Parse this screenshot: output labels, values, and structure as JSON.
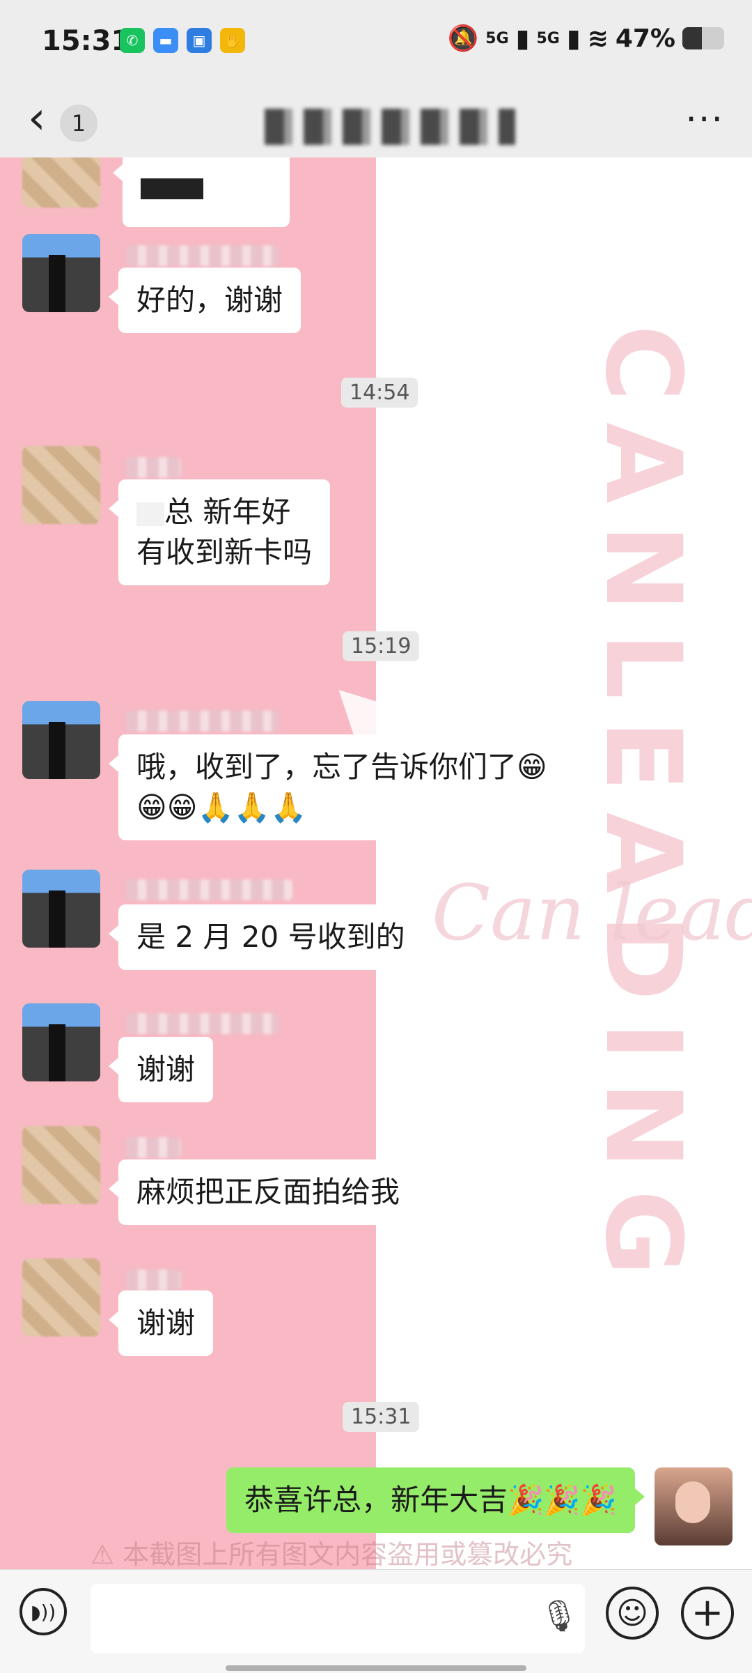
{
  "status_bar": {
    "time": "15:31",
    "network_1": "5G",
    "network_2": "5G",
    "battery_text": "47%",
    "battery_level": 0.47
  },
  "nav": {
    "unread_count": "1"
  },
  "watermarks": {
    "vertical_text": "CANLEADING",
    "brand_text": "Can leading",
    "bottom_caption": "⚠ 本截图上所有图文内容盗用或篡改必究"
  },
  "messages": [
    {
      "type": "text",
      "side": "left",
      "text": "好的，谢谢"
    },
    {
      "type": "time",
      "text": "14:54"
    },
    {
      "type": "text",
      "side": "left",
      "line1": "总 新年好",
      "line2": "有收到新卡吗"
    },
    {
      "type": "time",
      "text": "15:19"
    },
    {
      "type": "text",
      "side": "left",
      "line1": "哦，收到了，忘了告诉你们了😁",
      "line2": "😁😁🙏🙏🙏"
    },
    {
      "type": "text",
      "side": "left",
      "text": "是 2 月 20 号收到的"
    },
    {
      "type": "text",
      "side": "left",
      "text": "谢谢"
    },
    {
      "type": "text",
      "side": "left",
      "text": "麻烦把正反面拍给我"
    },
    {
      "type": "text",
      "side": "left",
      "text": "谢谢"
    },
    {
      "type": "time",
      "text": "15:31"
    },
    {
      "type": "text",
      "side": "right",
      "text": "恭喜许总，新年大吉🎉🎉🎉"
    }
  ],
  "input": {
    "value": "",
    "placeholder": ""
  },
  "icons": {
    "back": "chevron-left-icon",
    "more": "more-dots-icon",
    "voice": "voice-icon",
    "mic": "microphone-icon",
    "emoji": "emoji-icon",
    "plus": "plus-icon"
  },
  "colors": {
    "my_bubble": "#95ec69",
    "their_bubble": "#ffffff",
    "background_left": "#f8b8c4"
  }
}
